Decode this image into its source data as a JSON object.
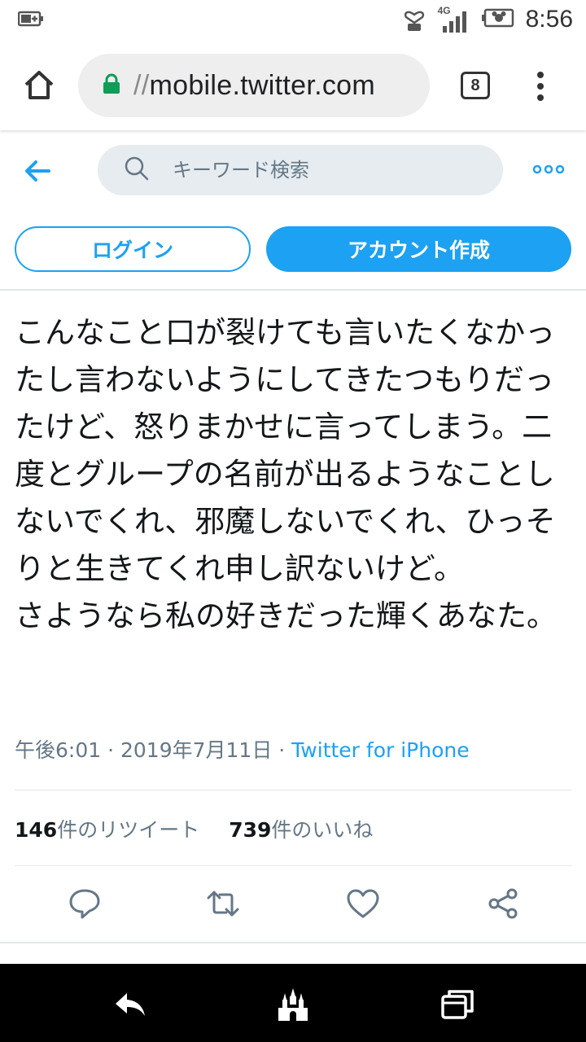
{
  "status_bar": {
    "network": "4G",
    "time": "8:56"
  },
  "browser": {
    "url_prefix": "//",
    "url_host": "mobile.twitter.com",
    "tab_count": "8"
  },
  "twitter_header": {
    "search_placeholder": "キーワード検索"
  },
  "auth": {
    "login_label": "ログイン",
    "signup_label": "アカウント作成"
  },
  "tweet": {
    "text": "こんなこと口が裂けても言いたくなかったし言わないようにしてきたつもりだったけど、怒りまかせに言ってしまう。二度とグループの名前が出るようなことしないでくれ、邪魔しないでくれ、ひっそりと生きてくれ申し訳ないけど。\nさようなら私の好きだった輝くあなた。",
    "time": "午後6:01",
    "separator": " · ",
    "date": "2019年7月11日",
    "source": "Twitter for iPhone"
  },
  "stats": {
    "retweet_count": "146",
    "retweet_label": "件のリツイート",
    "like_count": "739",
    "like_label": "件のいいね"
  },
  "colors": {
    "accent": "#1da1f2",
    "text": "#14171a",
    "muted": "#657786",
    "search_bg": "#e6ecf0"
  },
  "icons": {
    "status": [
      "battery-icon",
      "heart-signal-icon",
      "signal-icon",
      "battery-full-icon"
    ],
    "browser": [
      "home-icon",
      "lock-icon",
      "tabs-icon",
      "overflow-menu-icon"
    ],
    "header": [
      "back-arrow-icon",
      "search-icon",
      "more-dots-icon"
    ],
    "actions": [
      "reply-icon",
      "retweet-icon",
      "like-icon",
      "share-icon"
    ],
    "nav": [
      "back-icon",
      "castle-home-icon",
      "recents-icon"
    ]
  }
}
